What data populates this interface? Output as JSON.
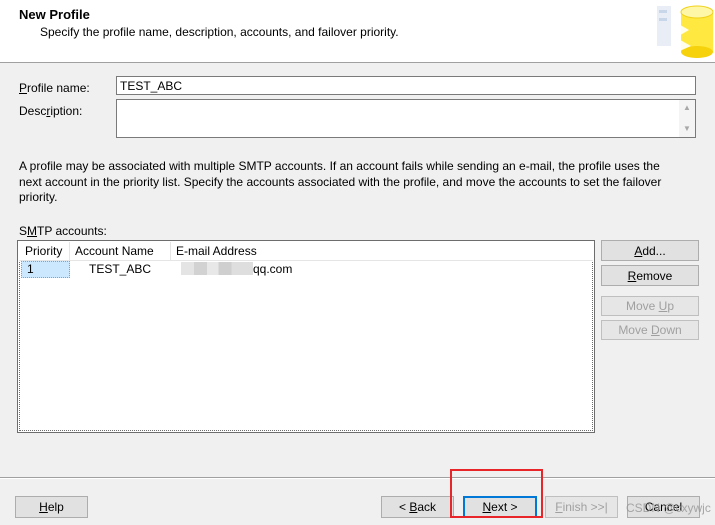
{
  "header": {
    "title": "New Profile",
    "subtitle": "Specify the profile name, description, accounts, and failover priority."
  },
  "form": {
    "profile_name_label_pre": "",
    "profile_name_label_key": "P",
    "profile_name_label_post": "rofile name:",
    "profile_name_value": "TEST_ABC",
    "description_label_pre": "Desc",
    "description_label_key": "r",
    "description_label_post": "iption:",
    "description_value": ""
  },
  "info_text": "A profile may be associated with multiple SMTP accounts. If an account fails while sending an e-mail, the profile uses the next account in the priority list. Specify the accounts associated with the profile, and move the accounts to set the failover priority.",
  "smtp": {
    "label_pre": "S",
    "label_key": "M",
    "label_post": "TP accounts:",
    "columns": [
      "Priority",
      "Account Name",
      "E-mail Address"
    ],
    "rows": [
      {
        "priority": "1",
        "account_name": "TEST_ABC",
        "email_suffix": "qq.com"
      }
    ]
  },
  "side_buttons": {
    "add_pre": "",
    "add_key": "A",
    "add_post": "dd...",
    "remove_pre": "",
    "remove_key": "R",
    "remove_post": "emove",
    "move_up_pre": "Move ",
    "move_up_key": "U",
    "move_up_post": "p",
    "move_down_pre": "Move ",
    "move_down_key": "D",
    "move_down_post": "own"
  },
  "footer": {
    "help_pre": "",
    "help_key": "H",
    "help_post": "elp",
    "back_pre": "< ",
    "back_key": "B",
    "back_post": "ack",
    "next_pre": "",
    "next_key": "N",
    "next_post": "ext >",
    "finish_pre": "",
    "finish_key": "F",
    "finish_post": "inish >>|",
    "cancel": "Cancel"
  },
  "watermark": "CSDN @cxywjc",
  "colors": {
    "accent": "#0078d7",
    "highlight_box": "#e8262a",
    "selection": "#cce8ff"
  }
}
